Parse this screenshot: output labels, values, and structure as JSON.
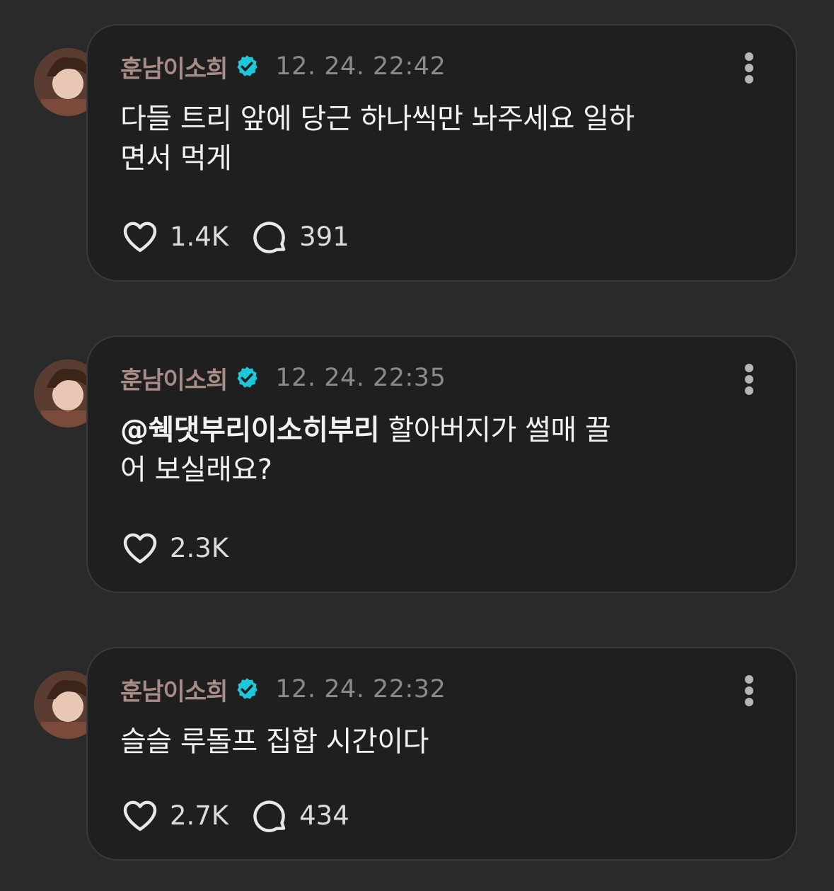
{
  "posts": [
    {
      "username": "훈남이소희",
      "timestamp": "12. 24. 22:42",
      "mention": "",
      "text": "다들 트리 앞에 당근 하나씩만 놔주세요 일하면서 먹게",
      "likes": "1.4K",
      "comments": "391"
    },
    {
      "username": "훈남이소희",
      "timestamp": "12. 24. 22:35",
      "mention": "@쉑댓부리이소히부리",
      "text": " 할아버지가 썰매 끌어 보실래요?",
      "likes": "2.3K",
      "comments": ""
    },
    {
      "username": "훈남이소희",
      "timestamp": "12. 24. 22:32",
      "mention": "",
      "text": "슬슬 루돌프 집합 시간이다",
      "likes": "2.7K",
      "comments": "434"
    }
  ],
  "icons": {
    "verified": "verified-badge-icon",
    "more": "more-vertical-icon",
    "like": "heart-icon",
    "comment": "comment-bubble-icon"
  },
  "colors": {
    "background": "#2a2a2a",
    "card": "#1f1f1f",
    "username": "#a78c87",
    "verified": "#1fc8d8",
    "text": "#f2f2f2",
    "muted": "#8a8a8a"
  }
}
